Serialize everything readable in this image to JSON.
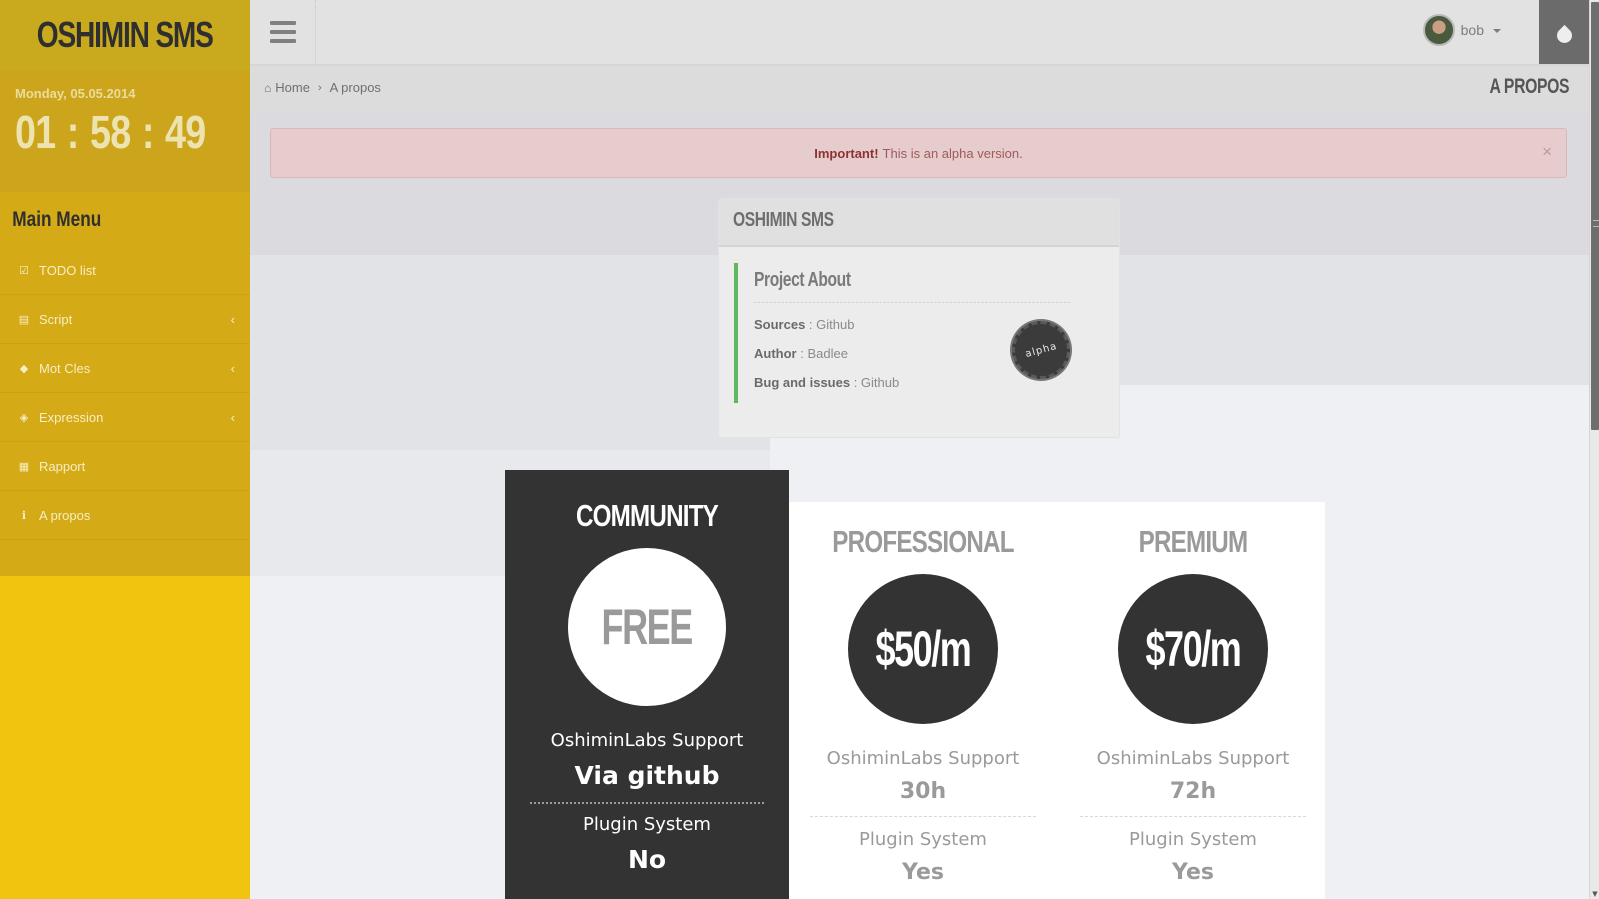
{
  "brand": "OSHIMIN SMS",
  "clock": {
    "date": "Monday, 05.05.2014",
    "hours": "01",
    "minutes": "58",
    "seconds": "49",
    "separator": ":"
  },
  "sidebar": {
    "title": "Main Menu",
    "items": [
      {
        "label": "TODO list",
        "icon": "check-square-icon",
        "glyph": "☑",
        "chevron": ""
      },
      {
        "label": "Script",
        "icon": "file-icon",
        "glyph": "▤",
        "chevron": "‹"
      },
      {
        "label": "Mot Cles",
        "icon": "tags-icon",
        "glyph": "◆",
        "chevron": "‹"
      },
      {
        "label": "Expression",
        "icon": "ticket-icon",
        "glyph": "◈",
        "chevron": "‹"
      },
      {
        "label": "Rapport",
        "icon": "table-icon",
        "glyph": "▦",
        "chevron": ""
      },
      {
        "label": "A propos",
        "icon": "info-icon",
        "glyph": "ℹ",
        "chevron": ""
      }
    ]
  },
  "topbar": {
    "menu_icon": "hamburger-icon",
    "user_name": "bob",
    "theme_icon": "droplet-icon"
  },
  "breadcrumb": {
    "home_glyph": "⌂",
    "home": "Home",
    "separator": "›",
    "current": "A propos",
    "page_title": "A PROPOS"
  },
  "alert": {
    "strong": "Important!",
    "text": "This is an alpha version.",
    "close": "×"
  },
  "panel": {
    "title": "OSHIMIN SMS",
    "about_title": "Project About",
    "lines": [
      {
        "label": "Sources",
        "value": " : Github"
      },
      {
        "label": "Author",
        "value": " : Badlee"
      },
      {
        "label": "Bug and issues",
        "value": " : Github"
      }
    ],
    "badge": "alpha"
  },
  "pricing": [
    {
      "name": "COMMUNITY",
      "price": "FREE",
      "support_label": "OshiminLabs Support",
      "support_value": "Via github",
      "plugin_label": "Plugin System",
      "plugin_value": "No"
    },
    {
      "name": "PROFESSIONAL",
      "price": "$50/m",
      "support_label": "OshiminLabs Support",
      "support_value": "30h",
      "plugin_label": "Plugin System",
      "plugin_value": "Yes"
    },
    {
      "name": "PREMIUM",
      "price": "$70/m",
      "support_label": "OshiminLabs Support",
      "support_value": "72h",
      "plugin_label": "Plugin System",
      "plugin_value": "Yes"
    }
  ],
  "colors": {
    "sidebar": "#f1c40f",
    "accent_green": "#5cb85c",
    "dark": "#333333",
    "alert_bg": "#e6cccd"
  }
}
